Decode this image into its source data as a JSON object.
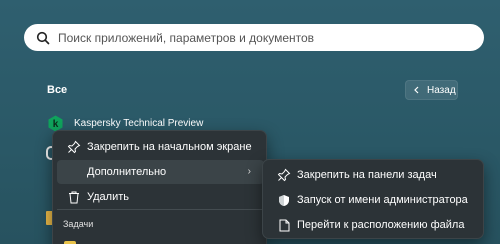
{
  "search": {
    "placeholder": "Поиск приложений, параметров и документов"
  },
  "all_apps": {
    "title": "Все",
    "back_label": "Назад"
  },
  "apps": [
    {
      "name": "Kaspersky Technical Preview",
      "icon": "kaspersky-k-icon"
    }
  ],
  "context_menu": {
    "items": [
      {
        "label": "Закрепить на начальном экране",
        "icon": "pin-icon"
      },
      {
        "label": "Дополнительно",
        "icon": "",
        "chevron": "›"
      },
      {
        "label": "Удалить",
        "icon": "trash-icon"
      }
    ],
    "group_label": "Задачи"
  },
  "submenu": {
    "items": [
      {
        "label": "Закрепить на панели задач",
        "icon": "pin-icon"
      },
      {
        "label": "Запуск от имени администратора",
        "icon": "shield-icon"
      },
      {
        "label": "Перейти к расположению файла",
        "icon": "file-icon"
      }
    ]
  },
  "colors": {
    "background": "#2a5866",
    "menu_bg": "#2c3337",
    "kaspersky": "#0fa35c"
  }
}
